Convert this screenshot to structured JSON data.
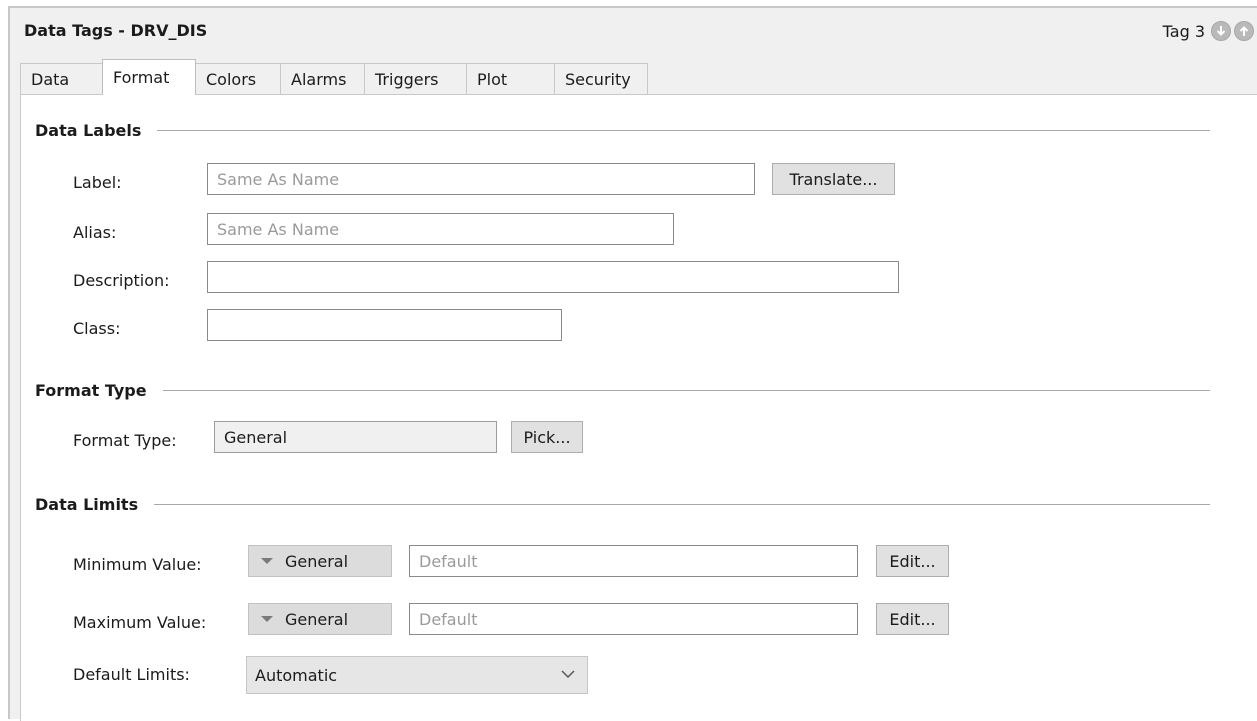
{
  "window": {
    "title": "Data Tags - DRV_DIS",
    "tag_label": "Tag 3"
  },
  "icons": {
    "prev": "arrow-down-circle-icon",
    "next": "arrow-up-circle-icon",
    "dropdown": "triangle-down-icon",
    "chevron": "chevron-down-icon"
  },
  "tabs": [
    {
      "label": "Data"
    },
    {
      "label": "Format"
    },
    {
      "label": "Colors"
    },
    {
      "label": "Alarms"
    },
    {
      "label": "Triggers"
    },
    {
      "label": "Plot"
    },
    {
      "label": "Security"
    }
  ],
  "active_tab": "Format",
  "data_labels": {
    "title": "Data Labels",
    "label": {
      "caption": "Label:",
      "value": "",
      "placeholder": "Same As Name"
    },
    "translate_button": "Translate...",
    "alias": {
      "caption": "Alias:",
      "value": "",
      "placeholder": "Same As Name"
    },
    "description": {
      "caption": "Description:",
      "value": ""
    },
    "class": {
      "caption": "Class:",
      "value": ""
    }
  },
  "format_type": {
    "title": "Format Type",
    "caption": "Format Type:",
    "value": "General",
    "pick_button": "Pick..."
  },
  "data_limits": {
    "title": "Data Limits",
    "minimum": {
      "caption": "Minimum Value:",
      "type": "General",
      "value": "",
      "placeholder": "Default",
      "edit_button": "Edit..."
    },
    "maximum": {
      "caption": "Maximum Value:",
      "type": "General",
      "value": "",
      "placeholder": "Default",
      "edit_button": "Edit..."
    },
    "default_limits": {
      "caption": "Default Limits:",
      "selected": "Automatic"
    }
  },
  "colors": {
    "window_bg": "#f0f0f0",
    "panel_bg": "#ffffff",
    "nav_button": "#b9b9b9"
  }
}
